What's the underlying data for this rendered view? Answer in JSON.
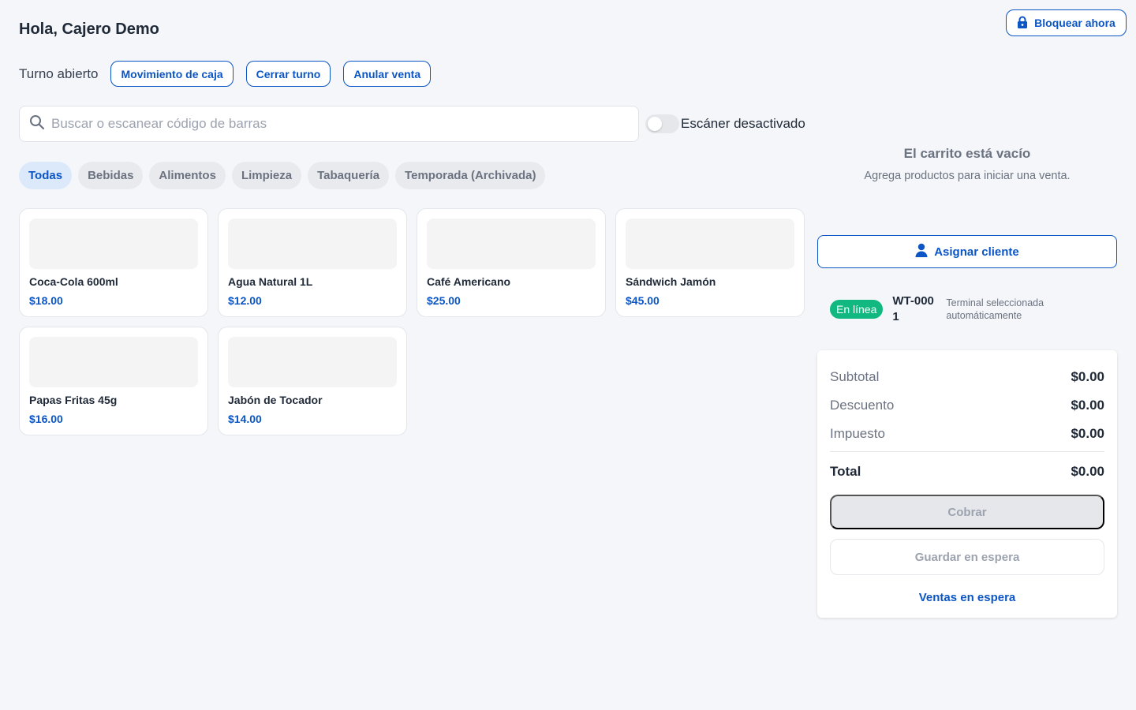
{
  "header": {
    "greeting": "Hola, Cajero Demo",
    "lock_label": "Bloquear ahora",
    "lock_icon": "lock-icon"
  },
  "shift": {
    "status": "Turno abierto",
    "actions": [
      "Movimiento de caja",
      "Cerrar turno",
      "Anular venta"
    ]
  },
  "search": {
    "placeholder": "Buscar o escanear código de barras",
    "value": "",
    "icon": "search-icon"
  },
  "scanner": {
    "label": "Escáner desactivado",
    "enabled": false
  },
  "categories": [
    {
      "label": "Todas",
      "active": true
    },
    {
      "label": "Bebidas",
      "active": false
    },
    {
      "label": "Alimentos",
      "active": false
    },
    {
      "label": "Limpieza",
      "active": false
    },
    {
      "label": "Tabaquería",
      "active": false
    },
    {
      "label": "Temporada (Archivada)",
      "active": false
    }
  ],
  "products": [
    {
      "name": "Coca-Cola 600ml",
      "price": "$18.00"
    },
    {
      "name": "Agua Natural 1L",
      "price": "$12.00"
    },
    {
      "name": "Café Americano",
      "price": "$25.00"
    },
    {
      "name": "Sándwich Jamón",
      "price": "$45.00"
    },
    {
      "name": "Papas Fritas 45g",
      "price": "$16.00"
    },
    {
      "name": "Jabón de Tocador",
      "price": "$14.00"
    }
  ],
  "cart": {
    "empty_title": "El carrito está vacío",
    "empty_subtitle": "Agrega productos para iniciar una venta.",
    "assign_client_label": "Asignar cliente",
    "assign_icon": "user-icon"
  },
  "terminal": {
    "status": "En línea",
    "id": "WT-0001",
    "note": "Terminal seleccionada automáticamente",
    "status_color": "#11b981"
  },
  "summary": {
    "subtotal_label": "Subtotal",
    "subtotal": "$0.00",
    "discount_label": "Descuento",
    "discount": "$0.00",
    "tax_label": "Impuesto",
    "tax": "$0.00",
    "total_label": "Total",
    "total": "$0.00",
    "charge_label": "Cobrar",
    "hold_label": "Guardar en espera",
    "held_sales_label": "Ventas en espera"
  },
  "colors": {
    "accent": "#0b55c4",
    "background": "#f4f6f9"
  }
}
